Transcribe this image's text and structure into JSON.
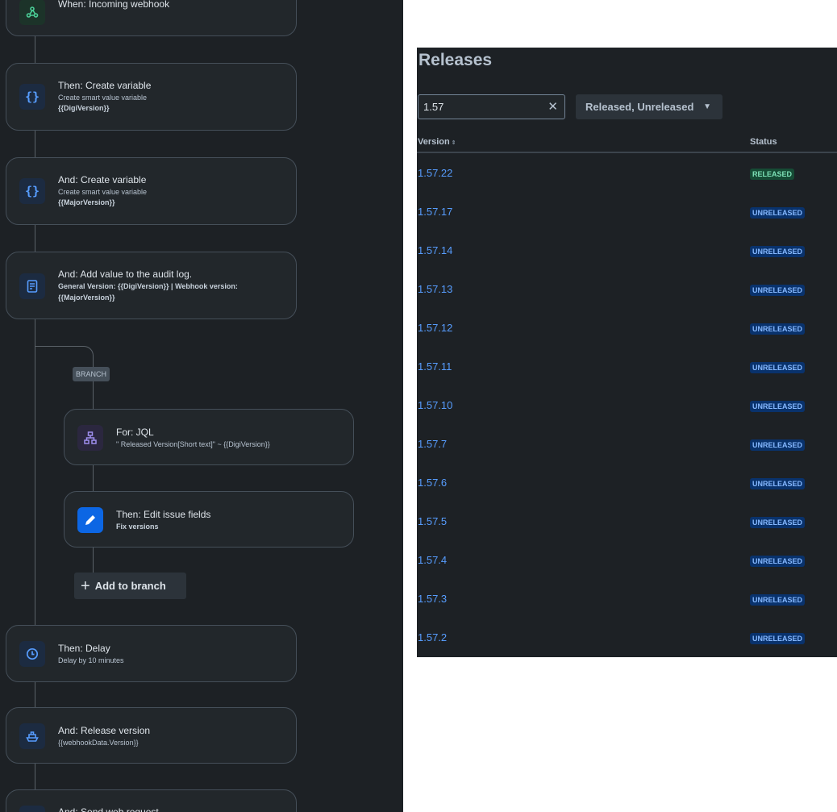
{
  "flow": {
    "trigger": {
      "title": "When: Incoming webhook",
      "icon": "webhook-icon"
    },
    "steps": [
      {
        "title": "Then: Create variable",
        "sub1": "Create smart value variable",
        "sub2": "{{DigiVersion}}",
        "icon": "curly-braces-icon"
      },
      {
        "title": "And: Create variable",
        "sub1": "Create smart value variable",
        "sub2": "{{MajorVersion}}",
        "icon": "curly-braces-icon"
      },
      {
        "title": "And: Add value to the audit log.",
        "sub1": "General Version: {{DigiVersion}} | Webhook version: {{MajorVersion}}",
        "icon": "audit-log-icon"
      }
    ],
    "branch_label": "BRANCH",
    "branch_steps": [
      {
        "title": "For: JQL",
        "sub1": "\" Released Version[Short text]\" ~ {{DigiVersion}}",
        "icon": "branch-hierarchy-icon"
      },
      {
        "title": "Then: Edit issue fields",
        "sub1": "Fix versions",
        "icon": "edit-pencil-icon"
      }
    ],
    "add_to_branch": "Add to branch",
    "after": [
      {
        "title": "Then: Delay",
        "sub1": "Delay by 10 minutes",
        "icon": "clock-icon"
      },
      {
        "title": "And: Release version",
        "sub1": "{{webhookData.Version}}",
        "icon": "ship-icon"
      },
      {
        "title": "And: Send web request",
        "icon": "web-request-icon"
      }
    ]
  },
  "releases": {
    "title": "Releases",
    "search_value": "1.57",
    "clear_icon": "close-icon",
    "filter_label": "Released, Unreleased",
    "columns": {
      "version": "Version",
      "status": "Status"
    },
    "sort_icon": "sort-arrows-icon",
    "rows": [
      {
        "version": "1.57.22",
        "status": "RELEASED"
      },
      {
        "version": "1.57.17",
        "status": "UNRELEASED"
      },
      {
        "version": "1.57.14",
        "status": "UNRELEASED"
      },
      {
        "version": "1.57.13",
        "status": "UNRELEASED"
      },
      {
        "version": "1.57.12",
        "status": "UNRELEASED"
      },
      {
        "version": "1.57.11",
        "status": "UNRELEASED"
      },
      {
        "version": "1.57.10",
        "status": "UNRELEASED"
      },
      {
        "version": "1.57.7",
        "status": "UNRELEASED"
      },
      {
        "version": "1.57.6",
        "status": "UNRELEASED"
      },
      {
        "version": "1.57.5",
        "status": "UNRELEASED"
      },
      {
        "version": "1.57.4",
        "status": "UNRELEASED"
      },
      {
        "version": "1.57.3",
        "status": "UNRELEASED"
      },
      {
        "version": "1.57.2",
        "status": "UNRELEASED"
      }
    ]
  }
}
